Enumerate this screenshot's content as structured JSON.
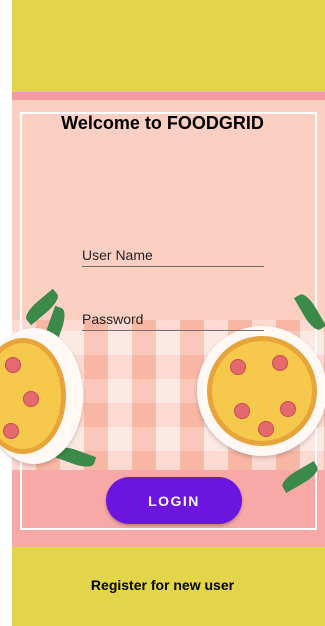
{
  "header": {
    "title": "Welcome to FOODGRID"
  },
  "form": {
    "username": {
      "label": "User Name"
    },
    "password": {
      "label": "Password"
    },
    "login_label": "LOGIN"
  },
  "footer": {
    "register_label": "Register for new user"
  },
  "colors": {
    "band": "#e3d54a",
    "background": "#fbd0c2",
    "strip": "#f49aa3",
    "button": "#6c14e0"
  }
}
